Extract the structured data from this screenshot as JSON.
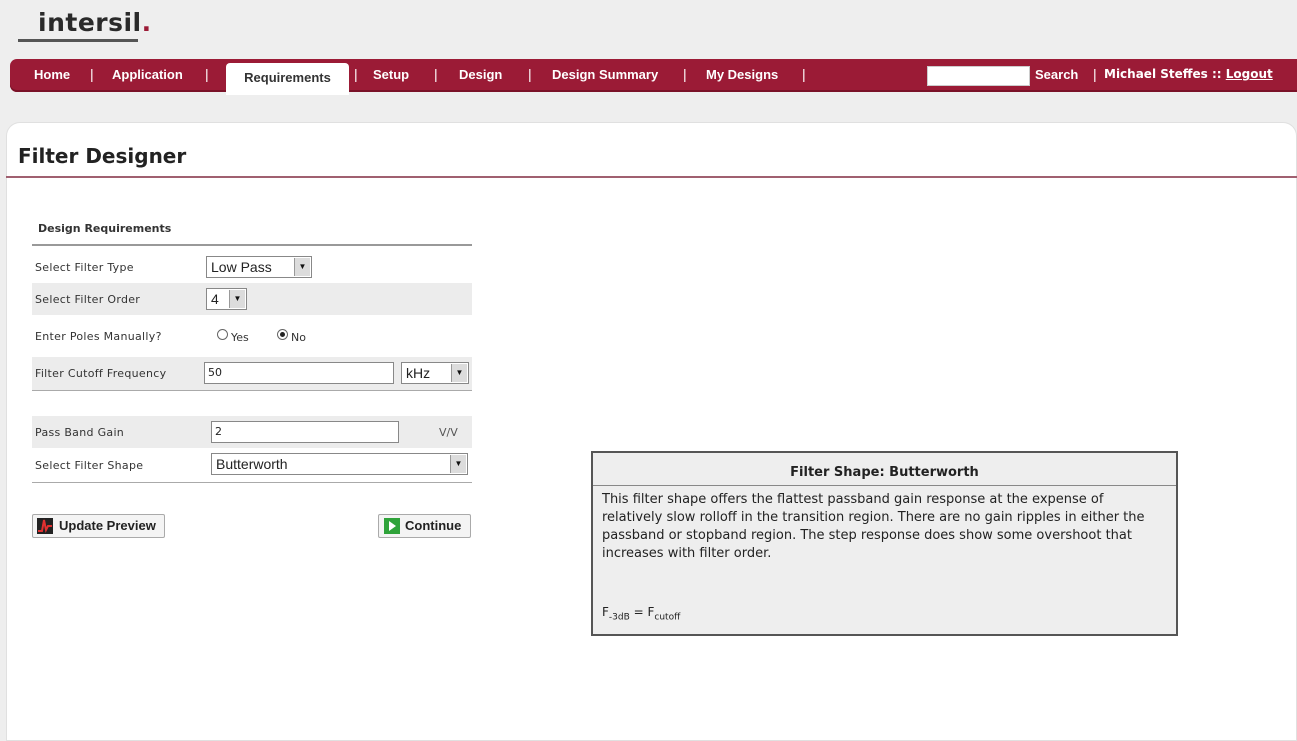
{
  "brand": {
    "logo_text": "intersil",
    "logo_mark": "."
  },
  "nav": {
    "items": [
      "Home",
      "Application",
      "Requirements",
      "Setup",
      "Design",
      "Design Summary",
      "My Designs"
    ],
    "active": "Requirements",
    "search_label": "Search",
    "search_value": "",
    "user_name": "Michael Steffes",
    "user_sep": "::",
    "logout_label": "Logout"
  },
  "page": {
    "title": "Filter Designer"
  },
  "form": {
    "section_title": "Design Requirements",
    "filter_type": {
      "label": "Select Filter Type",
      "value": "Low Pass"
    },
    "filter_order": {
      "label": "Select Filter Order",
      "value": "4"
    },
    "poles_manual": {
      "label": "Enter Poles Manually?",
      "yes_label": "Yes",
      "no_label": "No",
      "selected": "No"
    },
    "cutoff": {
      "label": "Filter Cutoff Frequency",
      "value": "50",
      "unit": "kHz"
    },
    "gain": {
      "label": "Pass Band Gain",
      "value": "2",
      "unit": "V/V"
    },
    "shape": {
      "label": "Select Filter Shape",
      "value": "Butterworth"
    },
    "update_button": "Update Preview",
    "continue_button": "Continue"
  },
  "info": {
    "title": "Filter Shape: Butterworth",
    "description": "This filter shape offers the flattest passband gain response at the expense of relatively slow rolloff in the transition region. There are no gain ripples in either the passband or stopband region. The step response does show some overshoot that increases with filter order.",
    "formula_lhs": "F",
    "formula_lhs_sub": "-3dB",
    "formula_eq": "=",
    "formula_rhs": "F",
    "formula_rhs_sub": "cutoff"
  },
  "colors": {
    "brand": "#9b1b36",
    "nav_text": "#ffffff",
    "page_bg": "#eeeeee"
  }
}
